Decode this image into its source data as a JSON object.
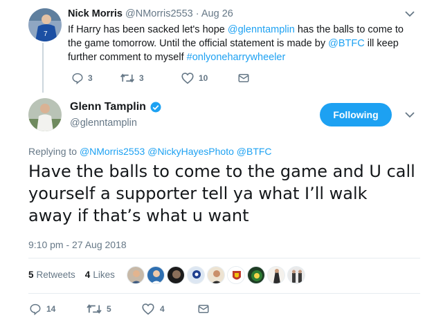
{
  "parent_tweet": {
    "name": "Nick Morris",
    "handle": "@NMorris2553",
    "separator": "·",
    "date": "Aug 26",
    "text_a": "If Harry has been sacked let's hope ",
    "mention_1": "@glenntamplin",
    "text_b": " has the balls to come to the game tomorrow.  Until the official statement is made by ",
    "mention_2": "@BTFC",
    "text_c": " ill keep further comment to myself ",
    "hashtag": "#onlyoneharrywheeler",
    "replies": "3",
    "retweets": "3",
    "likes": "10"
  },
  "main_tweet": {
    "name": "Glenn Tamplin",
    "handle": "@glenntamplin",
    "follow_label": "Following",
    "replying_prefix": "Replying to ",
    "replying_1": "@NMorris2553",
    "replying_2": "@NickyHayesPhoto",
    "replying_3": "@BTFC",
    "text": "Have the balls to come to the game and U call yourself a supporter tell ya what I’ll walk away if that’s what u want",
    "timestamp": "9:10 pm - 27 Aug 2018",
    "retweet_count": "5",
    "retweet_label": "Retweets",
    "like_count": "4",
    "like_label": "Likes",
    "replies": "14",
    "retweets": "5",
    "likes": "4"
  },
  "colors": {
    "accent": "#1da1f2",
    "muted": "#657786",
    "text": "#14171a",
    "divider": "#e6ecf0"
  },
  "icons": [
    "chevron-down-icon",
    "verified-badge-icon",
    "reply-icon",
    "retweet-icon",
    "like-icon",
    "message-icon"
  ]
}
